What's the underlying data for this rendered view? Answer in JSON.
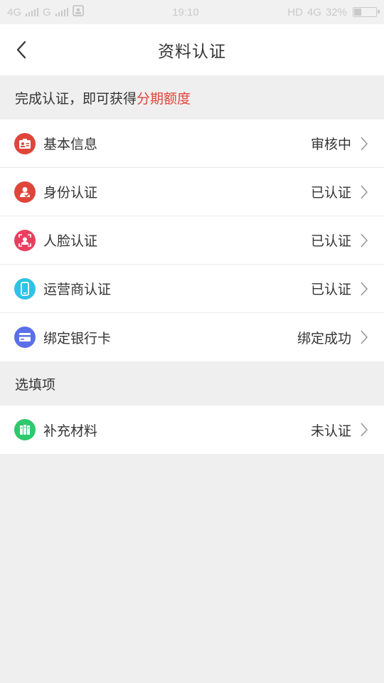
{
  "statusbar": {
    "network1": "4G",
    "network2": "G",
    "time": "19:10",
    "hd": "HD",
    "network3": "4G",
    "battery": "32%",
    "battery_level": 0.32
  },
  "header": {
    "title": "资料认证"
  },
  "promo": {
    "text": "完成认证，即可获得",
    "highlight": "分期额度"
  },
  "required_items": [
    {
      "label": "基本信息",
      "status": "审核中",
      "icon": "id-card-icon",
      "color": "#e0453b"
    },
    {
      "label": "身份认证",
      "status": "已认证",
      "icon": "identity-icon",
      "color": "#e0453b"
    },
    {
      "label": "人脸认证",
      "status": "已认证",
      "icon": "face-icon",
      "color": "#ea3e5f"
    },
    {
      "label": "运营商认证",
      "status": "已认证",
      "icon": "phone-icon",
      "color": "#2fc2e8"
    },
    {
      "label": "绑定银行卡",
      "status": "绑定成功",
      "icon": "bank-card-icon",
      "color": "#5b6fe8"
    }
  ],
  "optional_section": {
    "title": "选填项",
    "items": [
      {
        "label": "补充材料",
        "status": "未认证",
        "icon": "materials-icon",
        "color": "#2ec86d"
      }
    ]
  },
  "colors": {
    "accent": "#e0453b",
    "background": "#efefef"
  }
}
